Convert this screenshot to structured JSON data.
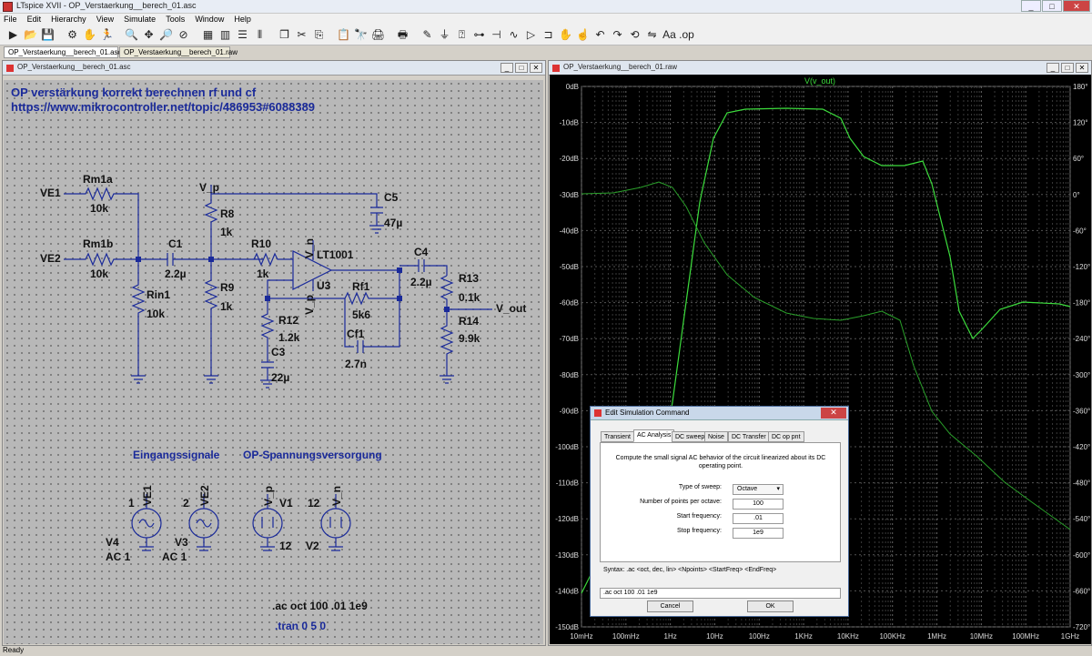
{
  "app": {
    "title": "LTspice XVII - OP_Verstaerkung__berech_01.asc",
    "window_buttons": {
      "minimize": "_",
      "maximize": "□",
      "close": "✕"
    }
  },
  "menu": [
    "File",
    "Edit",
    "Hierarchy",
    "View",
    "Simulate",
    "Tools",
    "Window",
    "Help"
  ],
  "toolbar_icons": [
    "run-icon",
    "open-icon",
    "save-icon",
    "control-panel-icon",
    "halt-icon",
    "run-to-icon",
    "zoom-in-icon",
    "pan-icon",
    "zoom-out-icon",
    "zoom-cancel-icon",
    "autorange-icon",
    "fft-icon",
    "tile-horizontal-icon",
    "tile-vertical-icon",
    "cascade-icon",
    "cut-icon",
    "copy-icon",
    "paste-icon",
    "find-icon",
    "print-icon",
    "print-setup-icon",
    "wire-icon",
    "ground-icon",
    "label-icon",
    "resistor-icon",
    "capacitor-icon",
    "inductor-icon",
    "diode-icon",
    "component-icon",
    "move-icon",
    "drag-icon",
    "undo-icon",
    "redo-icon",
    "rotate-icon",
    "mirror-icon",
    "text-icon",
    "spice-directive-icon"
  ],
  "toolbar_glyphs": [
    "▶",
    "📂",
    "💾",
    "⚙",
    "✋",
    "🏃",
    "🔍",
    "✥",
    "🔎",
    "⊘",
    "▦",
    "▥",
    "☰",
    "⫴",
    "❐",
    "✂",
    "⎘",
    "📋",
    "🔭",
    "🖨",
    "🖶",
    "✎",
    "⏚",
    "⍰",
    "⊶",
    "⊣",
    "∿",
    "▷",
    "⊐",
    "✋",
    "☝",
    "↶",
    "↷",
    "⟲",
    "⇋",
    "Aa",
    ".op"
  ],
  "tabs": [
    {
      "label": "OP_Verstaerkung__berech_01.asc",
      "active": true
    },
    {
      "label": "OP_Verstaerkung__berech_01.raw",
      "active": false
    }
  ],
  "schematic": {
    "title": "OP_Verstaerkung__berech_01.asc",
    "heading1": "OP verstärkung korrekt berechnen rf und cf",
    "heading2": "https://www.mikrocontroller.net/topic/486953#6088389",
    "labels": {
      "VE1": "VE1",
      "VE2": "VE2",
      "Rm1a": "Rm1a",
      "Rm1a_val": "10k",
      "Rm1b": "Rm1b",
      "Rm1b_val": "10k",
      "C1": "C1",
      "C1_val": "2.2µ",
      "Rin1": "Rin1",
      "Rin1_val": "10k",
      "Vp": "V_p",
      "R8": "R8",
      "R8_val": "1k",
      "R9": "R9",
      "R9_val": "1k",
      "R10": "R10",
      "R10_val": "1k",
      "C5": "C5",
      "C5_val": "47µ",
      "Vn": "V_n",
      "LT1001": "LT1001",
      "U3": "U3",
      "Vp2": "V_p",
      "Rf1": "Rf1",
      "Rf1_val": "5k6",
      "Cf1": "Cf1",
      "Cf1_val": "2.7n",
      "R12": "R12",
      "R12_val": "1.2k",
      "C3": "C3",
      "C3_val": "22µ",
      "C4": "C4",
      "C4_val": "2.2µ",
      "R13": "R13",
      "R13_val": "0.1k",
      "R14": "R14",
      "R14_val": "9.9k",
      "Vout": "V_out"
    },
    "section1": "Eingangssignale",
    "section2": "OP-Spannungsversorgung",
    "sources": [
      {
        "net": "VE1",
        "pin": "1",
        "name": "V4",
        "value": "AC 1"
      },
      {
        "net": "VE2",
        "pin": "2",
        "name": "V3",
        "value": "AC 1"
      },
      {
        "net": "V_p",
        "pin": "",
        "name": "V1",
        "value": "12"
      },
      {
        "net": "V_n",
        "pin": "12",
        "name": "V2",
        "value": ""
      }
    ],
    "directive_ac": ".ac oct 100 .01 1e9",
    "directive_tran": ".tran 0 5 0"
  },
  "plot": {
    "title": "OP_Verstaerkung__berech_01.raw",
    "trace": "V(v_out)",
    "y_left": [
      "0dB",
      "-10dB",
      "-20dB",
      "-30dB",
      "-40dB",
      "-50dB",
      "-60dB",
      "-70dB",
      "-80dB",
      "-90dB",
      "-100dB",
      "-110dB",
      "-120dB",
      "-130dB",
      "-140dB",
      "-150dB"
    ],
    "y_right": [
      "180°",
      "120°",
      "60°",
      "0°",
      "-60°",
      "-120°",
      "-180°",
      "-240°",
      "-300°",
      "-360°",
      "-420°",
      "-480°",
      "-540°",
      "-600°",
      "-660°",
      "-720°"
    ],
    "x": [
      "10mHz",
      "100mHz",
      "1Hz",
      "10Hz",
      "100Hz",
      "1KHz",
      "10KHz",
      "100KHz",
      "1MHz",
      "10MHz",
      "100MHz",
      "1GHz"
    ]
  },
  "dialog": {
    "title": "Edit Simulation Command",
    "tabs": [
      "Transient",
      "AC Analysis",
      "DC sweep",
      "Noise",
      "DC Transfer",
      "DC op pnt"
    ],
    "active_tab": "AC Analysis",
    "description": "Compute the small signal AC behavior of the circuit linearized about its DC operating point.",
    "fields": [
      {
        "label": "Type of sweep:",
        "value": "Octave"
      },
      {
        "label": "Number of points per octave:",
        "value": "100"
      },
      {
        "label": "Start frequency:",
        "value": ".01"
      },
      {
        "label": "Stop frequency:",
        "value": "1e9"
      }
    ],
    "syntax": "Syntax:  .ac <oct, dec, lin> <Npoints> <StartFreq> <EndFreq>",
    "command": ".ac oct 100 .01 1e9",
    "cancel": "Cancel",
    "ok": "OK"
  },
  "status": "Ready"
}
